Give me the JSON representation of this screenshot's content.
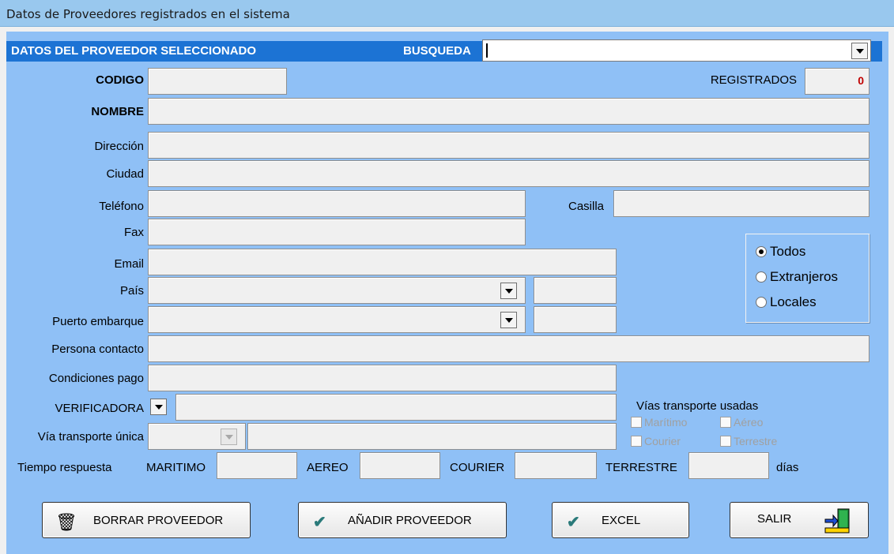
{
  "window": {
    "title": "Datos de Proveedores registrados en el sistema"
  },
  "header": {
    "section_title": "DATOS DEL PROVEEDOR SELECCIONADO",
    "search_label": "BUSQUEDA",
    "search_value": ""
  },
  "labels": {
    "codigo": "CODIGO",
    "registrados": "REGISTRADOS",
    "nombre": "NOMBRE",
    "direccion": "Dirección",
    "ciudad": "Ciudad",
    "telefono": "Teléfono",
    "casilla": "Casilla",
    "fax": "Fax",
    "email": "Email",
    "pais": "País",
    "puerto_embarque": "Puerto embarque",
    "persona_contacto": "Persona contacto",
    "condiciones_pago": "Condiciones pago",
    "verificadora": "VERIFICADORA",
    "via_transporte_unica": "Vía transporte única",
    "tiempo_respuesta": "Tiempo respuesta",
    "maritimo": "MARITIMO",
    "aereo": "AEREO",
    "courier": "COURIER",
    "terrestre": "TERRESTRE",
    "dias": "días"
  },
  "values": {
    "registrados_count": "0"
  },
  "filter": {
    "options": [
      {
        "label": "Todos",
        "selected": true
      },
      {
        "label": "Extranjeros",
        "selected": false
      },
      {
        "label": "Locales",
        "selected": false
      }
    ]
  },
  "transport": {
    "title": "Vías transporte usadas",
    "options": [
      "Marítimo",
      "Aéreo",
      "Courier",
      "Terrestre"
    ]
  },
  "buttons": {
    "borrar": "BORRAR PROVEEDOR",
    "anadir": "AÑADIR PROVEEDOR",
    "excel": "EXCEL",
    "salir": "SALIR"
  },
  "icons": {
    "borrar": "trash-icon",
    "anadir": "checkmark-icon",
    "excel": "checkmark-icon",
    "salir": "exit-door-icon"
  },
  "colors": {
    "form_bg": "#8fc0f6",
    "header_bar": "#1c73d4",
    "title_bar": "#99c8ee",
    "count_text": "#c00000"
  }
}
